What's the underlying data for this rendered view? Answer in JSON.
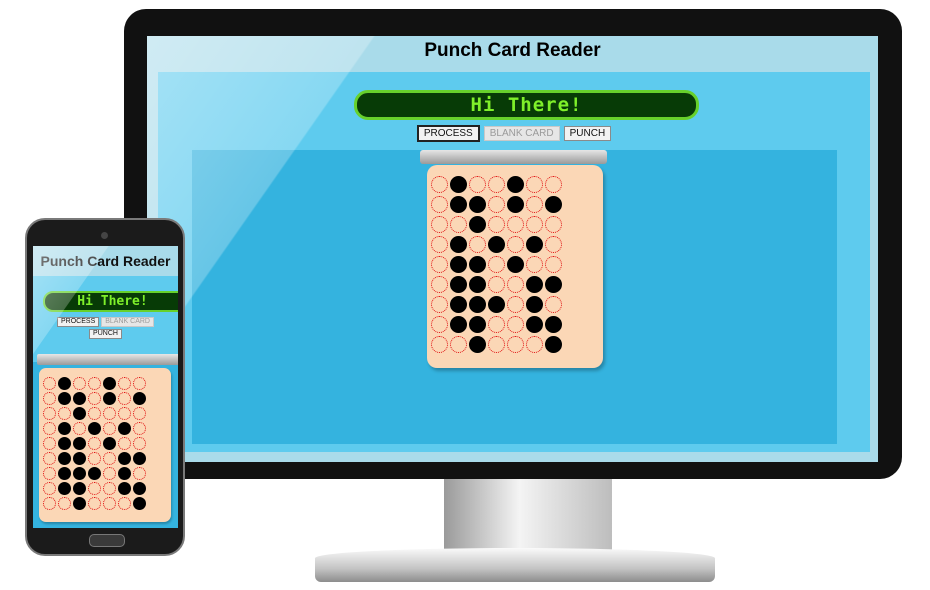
{
  "app": {
    "title": "Punch Card Reader"
  },
  "display": {
    "text": "Hi There!"
  },
  "buttons": {
    "process": "PROCESS",
    "blank_card": "BLANK CARD",
    "punch": "PUNCH"
  },
  "colors": {
    "display_bg": "#073b06",
    "display_text": "#7ff02a",
    "card": "#fbd7b6",
    "panel": "#5ecbee",
    "card_area": "#34b3df"
  },
  "card": {
    "columns": 7,
    "rows": 9,
    "punched": [
      [
        0,
        1,
        0,
        0,
        1,
        0,
        0
      ],
      [
        0,
        1,
        1,
        0,
        1,
        0,
        1
      ],
      [
        0,
        0,
        1,
        0,
        0,
        0,
        0
      ],
      [
        0,
        1,
        0,
        1,
        0,
        1,
        0
      ],
      [
        0,
        1,
        1,
        0,
        1,
        0,
        0
      ],
      [
        0,
        1,
        1,
        0,
        0,
        1,
        1
      ],
      [
        0,
        1,
        1,
        1,
        0,
        1,
        0
      ],
      [
        0,
        1,
        1,
        0,
        0,
        1,
        1
      ],
      [
        0,
        0,
        1,
        0,
        0,
        0,
        1
      ]
    ]
  }
}
